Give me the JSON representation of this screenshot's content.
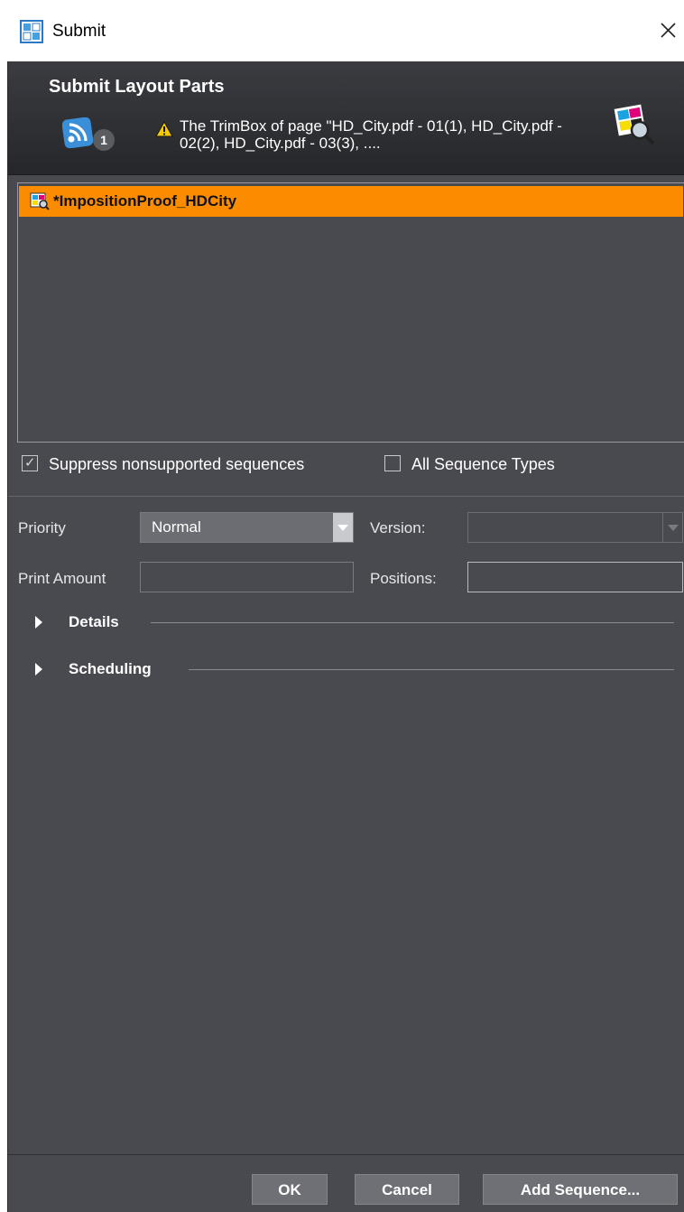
{
  "window": {
    "title": "Submit"
  },
  "header": {
    "title": "Submit Layout Parts",
    "badge_count": "1",
    "message": "The TrimBox of page \"HD_City.pdf - 01(1), HD_City.pdf - 02(2), HD_City.pdf - 03(3), ...."
  },
  "list": {
    "items": [
      {
        "label": "*ImpositionProof_HDCity",
        "selected": true
      }
    ]
  },
  "options": {
    "suppress_label": "Suppress nonsupported sequences",
    "suppress_checked": true,
    "all_types_label": "All Sequence Types",
    "all_types_checked": false
  },
  "form": {
    "priority_label": "Priority",
    "priority_value": "Normal",
    "version_label": "Version:",
    "version_value": "",
    "print_amount_label": "Print Amount",
    "print_amount_value": "",
    "positions_label": "Positions:",
    "positions_value": ""
  },
  "sections": {
    "details": "Details",
    "scheduling": "Scheduling"
  },
  "buttons": {
    "ok": "OK",
    "cancel": "Cancel",
    "add_sequence": "Add Sequence..."
  },
  "colors": {
    "accent": "#fb8c00",
    "background": "#494a50"
  }
}
